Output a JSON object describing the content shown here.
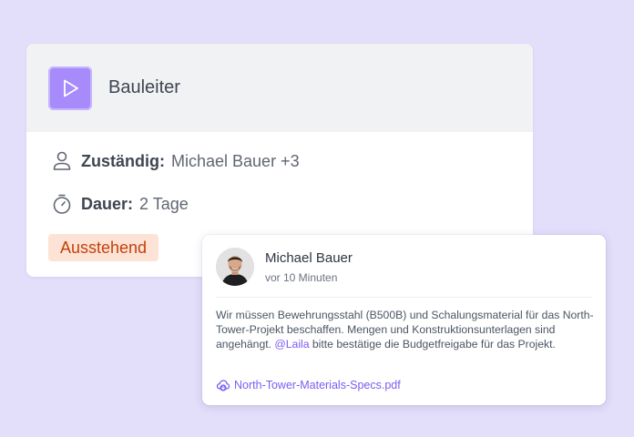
{
  "task": {
    "title": "Bauleiter",
    "icon": "play-icon",
    "assignee_label": "Zuständig:",
    "assignee_value": "Michael Bauer +3",
    "assignee_icon": "user-icon",
    "duration_label": "Dauer:",
    "duration_value": "2 Tage",
    "duration_icon": "stopwatch-icon",
    "status": "Ausstehend"
  },
  "comment": {
    "author": "Michael Bauer",
    "time": "vor 10 Minuten",
    "body_before": "Wir müssen Bewehrungsstahl (B500B) und Schalungsmaterial für das North-Tower-Projekt beschaffen. Mengen und Konstruktionsunterlagen sind angehängt. ",
    "mention": "@Laila",
    "body_after": " bitte bestätige die Budgetfreigabe für das Projekt.",
    "attachment_name": "North-Tower-Materials-Specs.pdf",
    "attachment_icon": "cloud-download-icon"
  },
  "colors": {
    "background": "#e3defa",
    "accent": "#a78bfa",
    "link": "#7c5cf2",
    "status_bg": "#fde3d5",
    "status_text": "#c2410c"
  }
}
